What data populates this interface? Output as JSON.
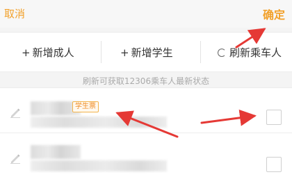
{
  "header": {
    "cancel_label": "取消",
    "confirm_label": "确定"
  },
  "actions": {
    "add_adult": {
      "plus": "+",
      "label": "新增成人"
    },
    "add_student": {
      "plus": "+",
      "label": "新增学生"
    },
    "refresh": {
      "label": "刷新乘车人"
    }
  },
  "status": {
    "text": "刷新可获取12306乘车人最新状态"
  },
  "passengers": [
    {
      "badge": "学生票",
      "checked": false
    },
    {
      "checked": false
    }
  ],
  "colors": {
    "accent": "#f2a12b",
    "annotation_arrow": "#e53935"
  },
  "icons": {
    "edit": "pencil-icon",
    "refresh": "refresh-icon"
  }
}
